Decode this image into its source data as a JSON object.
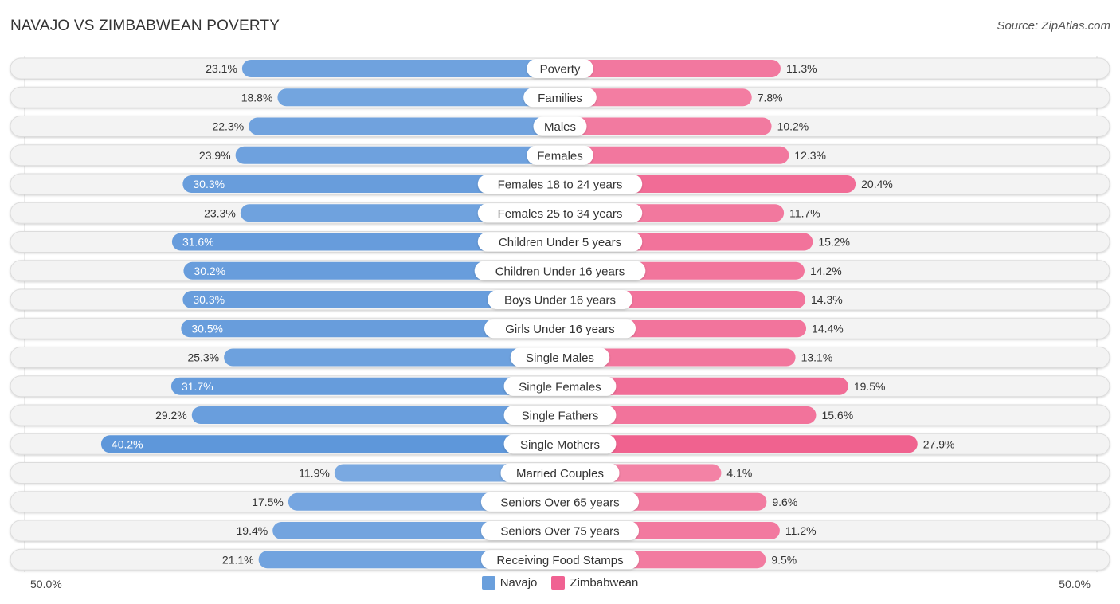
{
  "header": {
    "title": "NAVAJO VS ZIMBABWEAN POVERTY",
    "source": "Source: ZipAtlas.com"
  },
  "chart_data": {
    "type": "bar",
    "orientation": "diverging-horizontal",
    "title": "NAVAJO VS ZIMBABWEAN POVERTY",
    "xlim": [
      0,
      50
    ],
    "axis_labels": {
      "left": "50.0%",
      "right": "50.0%"
    },
    "legend": {
      "position": "bottom-center"
    },
    "categories": [
      "Poverty",
      "Families",
      "Males",
      "Females",
      "Females 18 to 24 years",
      "Females 25 to 34 years",
      "Children Under 5 years",
      "Children Under 16 years",
      "Boys Under 16 years",
      "Girls Under 16 years",
      "Single Males",
      "Single Females",
      "Single Fathers",
      "Single Mothers",
      "Married Couples",
      "Seniors Over 65 years",
      "Seniors Over 75 years",
      "Receiving Food Stamps"
    ],
    "series": [
      {
        "name": "Navajo",
        "color": "#6a9fdc",
        "values": [
          23.1,
          18.8,
          22.3,
          23.9,
          30.3,
          23.3,
          31.6,
          30.2,
          30.3,
          30.5,
          25.3,
          31.7,
          29.2,
          40.2,
          11.9,
          17.5,
          19.4,
          21.1
        ],
        "labels": [
          "23.1%",
          "18.8%",
          "22.3%",
          "23.9%",
          "30.3%",
          "23.3%",
          "31.6%",
          "30.2%",
          "30.3%",
          "30.5%",
          "25.3%",
          "31.7%",
          "29.2%",
          "40.2%",
          "11.9%",
          "17.5%",
          "19.4%",
          "21.1%"
        ]
      },
      {
        "name": "Zimbabwean",
        "color": "#f06292",
        "values": [
          11.3,
          7.8,
          10.2,
          12.3,
          20.4,
          11.7,
          15.2,
          14.2,
          14.3,
          14.4,
          13.1,
          19.5,
          15.6,
          27.9,
          4.1,
          9.6,
          11.2,
          9.5
        ],
        "labels": [
          "11.3%",
          "7.8%",
          "10.2%",
          "12.3%",
          "20.4%",
          "11.7%",
          "15.2%",
          "14.2%",
          "14.3%",
          "14.4%",
          "13.1%",
          "19.5%",
          "15.6%",
          "27.9%",
          "4.1%",
          "9.6%",
          "11.2%",
          "9.5%"
        ]
      }
    ]
  }
}
